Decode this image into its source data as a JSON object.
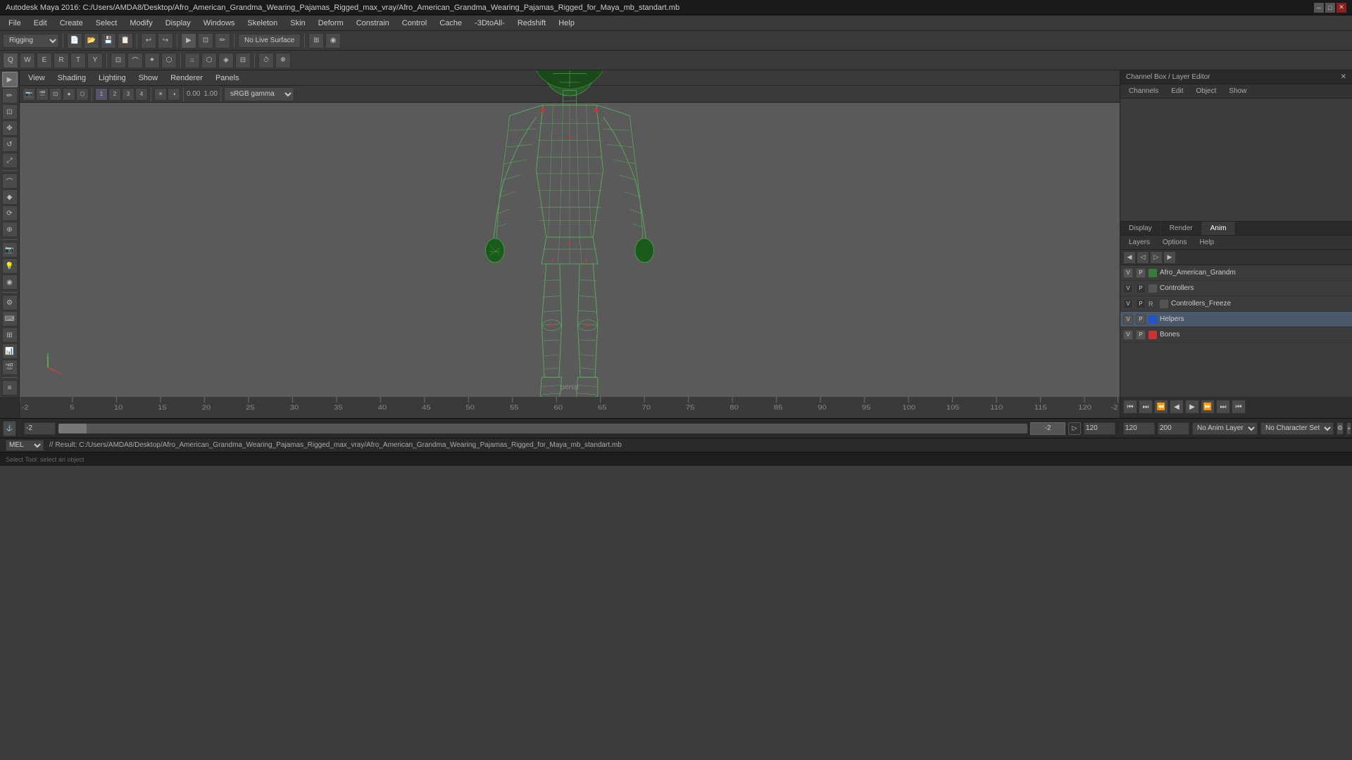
{
  "window": {
    "title": "Autodesk Maya 2016: C:/Users/AMDA8/Desktop/Afro_American_Grandma_Wearing_Pajamas_Rigged_max_vray/Afro_American_Grandma_Wearing_Pajamas_Rigged_for_Maya_mb_standart.mb"
  },
  "menu": {
    "items": [
      "File",
      "Edit",
      "Create",
      "Select",
      "Modify",
      "Display",
      "Windows",
      "Skeleton",
      "Skin",
      "Deform",
      "Constrain",
      "Control",
      "Cache",
      "-3DtoAll-",
      "Redshift",
      "Help"
    ]
  },
  "toolbar1": {
    "mode_dropdown": "Rigging",
    "live_surface": "No Live Surface"
  },
  "viewport_menu": {
    "items": [
      "View",
      "Shading",
      "Lighting",
      "Show",
      "Renderer",
      "Panels"
    ]
  },
  "viewport": {
    "persp_label": "persp",
    "color_space": "sRGB gamma",
    "value1": "0.00",
    "value2": "1.00"
  },
  "channel_box": {
    "title": "Channel Box / Layer Editor",
    "tabs": [
      "Channels",
      "Edit",
      "Object",
      "Show"
    ]
  },
  "layer_editor": {
    "tabs": [
      "Display",
      "Render",
      "Anim"
    ],
    "active_tab": "Anim",
    "sub_tabs": [
      "Layers",
      "Options",
      "Help"
    ],
    "layers": [
      {
        "name": "Afro_American_Grandm",
        "v": true,
        "p": true,
        "r": false,
        "color": "#3a7a3a"
      },
      {
        "name": "Controllers",
        "v": false,
        "p": false,
        "r": false,
        "color": null
      },
      {
        "name": "Controllers_Freeze",
        "v": false,
        "p": false,
        "r": true,
        "color": null
      },
      {
        "name": "Helpers",
        "v": true,
        "p": true,
        "r": false,
        "color": "#2255cc"
      },
      {
        "name": "Bones",
        "v": true,
        "p": true,
        "r": false,
        "color": "#cc3333"
      }
    ]
  },
  "timeline": {
    "ticks": [
      "-2",
      "5",
      "10",
      "15",
      "20",
      "25",
      "30",
      "35",
      "40",
      "45",
      "50",
      "55",
      "60",
      "65",
      "70",
      "75",
      "80",
      "85",
      "90",
      "95",
      "100",
      "105",
      "110",
      "115",
      "120",
      "-2"
    ],
    "current_frame": "-2"
  },
  "playback": {
    "buttons": [
      "⏮",
      "⏭",
      "⏪",
      "◀",
      "▶",
      "⏩",
      "⏫",
      "⏬"
    ]
  },
  "range_bar": {
    "start": "-2",
    "end": "120",
    "current": "-2",
    "max": "200",
    "anim_layer": "No Anim Layer",
    "char_set": "No Character Set"
  },
  "status_bar": {
    "mode": "MEL",
    "result_text": "// Result: C:/Users/AMDA8/Desktop/Afro_American_Grandma_Wearing_Pajamas_Rigged_max_vray/Afro_American_Grandma_Wearing_Pajamas_Rigged_for_Maya_mb_standart.mb"
  },
  "bottom_bar": {
    "text": "Select Tool: select an object"
  },
  "icons": {
    "select": "▶",
    "move": "✥",
    "rotate": "↺",
    "scale": "⤢",
    "lasso": "⊡",
    "paint": "✏",
    "close": "✕",
    "minimize": "─",
    "maximize": "□"
  }
}
